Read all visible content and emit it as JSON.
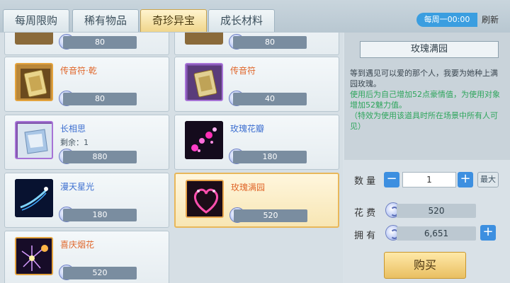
{
  "tabs": [
    {
      "label": "每周限购"
    },
    {
      "label": "稀有物品"
    },
    {
      "label": "奇珍异宝",
      "active": true
    },
    {
      "label": "成长材料"
    }
  ],
  "refresh": {
    "time": "每周一00:00",
    "label": "刷新"
  },
  "items": [
    {
      "name": "",
      "price": "80"
    },
    {
      "name": "",
      "price": "80"
    },
    {
      "name": "传音符·乾",
      "price": "80",
      "color": "orange",
      "icon": "gold-talisman-icon"
    },
    {
      "name": "传音符",
      "price": "40",
      "color": "orange",
      "icon": "gold-talisman-icon"
    },
    {
      "name": "长相思",
      "remain": "剩余：1",
      "price": "880",
      "color": "blue",
      "icon": "silk-pouch-icon"
    },
    {
      "name": "玫瑰花瓣",
      "price": "180",
      "color": "blue",
      "icon": "rose-petal-icon"
    },
    {
      "name": "漫天星光",
      "price": "180",
      "color": "blue",
      "icon": "starlight-icon"
    },
    {
      "name": "玫瑰满园",
      "price": "520",
      "color": "orange",
      "icon": "heart-rose-icon",
      "selected": true
    },
    {
      "name": "喜庆烟花",
      "price": "520",
      "color": "orange",
      "icon": "firework-icon"
    }
  ],
  "detail": {
    "title": "玫瑰满园",
    "desc1": "等到遇见可以爱的那个人，我要为她种上满园玫瑰。",
    "desc2": "使用后为自己增加52点豪情值，为使用对象增加52魅力值。",
    "desc3": "（特效为使用该道具时所在场景中所有人可见）",
    "qty_label": "数  量",
    "qty_value": "1",
    "minus": "−",
    "plus": "+",
    "max_label": "最大",
    "cost_label": "花  费",
    "cost_value": "520",
    "own_label": "拥  有",
    "own_value": "6,651",
    "add": "+",
    "buy_label": "购买"
  },
  "colors": {
    "accent": "#3d8fe0",
    "orange_text": "#e0672b",
    "blue_text": "#3d6fd0",
    "green_text": "#2ea55c"
  }
}
